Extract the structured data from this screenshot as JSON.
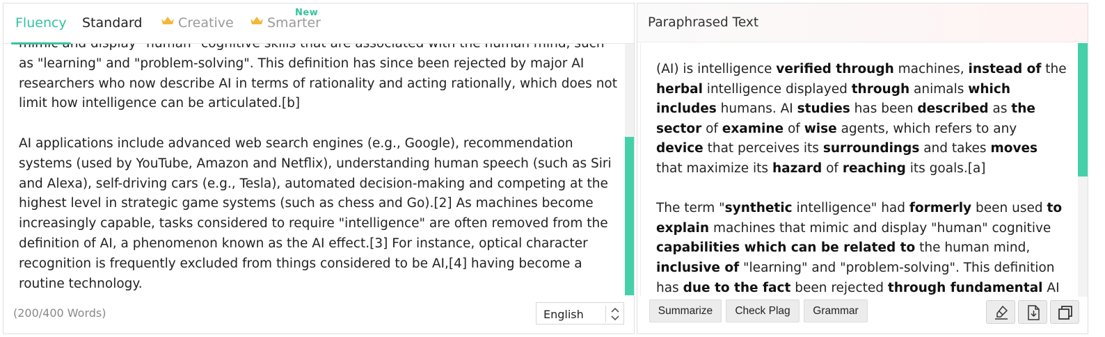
{
  "tabs": [
    {
      "label": "Fluency",
      "active": true,
      "premium": false
    },
    {
      "label": "Standard",
      "active": false,
      "premium": false
    },
    {
      "label": "Creative",
      "active": false,
      "premium": true
    },
    {
      "label": "Smarter",
      "active": false,
      "premium": true,
      "badge": "New"
    }
  ],
  "colors": {
    "accent": "#34c3a0",
    "scroll_thumb": "#44d1aa",
    "crown": "#f4b73a"
  },
  "source": {
    "paragraphs": [
      "mimic and display \"human\" cognitive skills that are associated with the human mind, such as \"learning\" and \"problem-solving\". This definition has since been rejected by major AI researchers who now describe AI in terms of rationality and acting rationally, which does not limit how intelligence can be articulated.[b]",
      "AI applications include advanced web search engines (e.g., Google), recommendation systems (used by YouTube, Amazon and Netflix), understanding human speech (such as Siri and Alexa), self-driving cars (e.g., Tesla), automated decision-making and competing at the highest level in strategic game systems (such as chess and Go).[2] As machines become increasingly capable, tasks considered to require \"intelligence\" are often removed from the definition of AI, a phenomenon known as the AI effect.[3] For instance, optical character recognition is frequently excluded from things considered to be AI,[4] having become a routine technology."
    ],
    "word_count": "(200/400 Words)",
    "language": "English"
  },
  "output": {
    "title": "Paraphrased Text",
    "paragraphs": [
      [
        {
          "t": "(AI) is intelligence ",
          "b": false
        },
        {
          "t": "verified through",
          "b": true
        },
        {
          "t": " machines, ",
          "b": false
        },
        {
          "t": "instead of",
          "b": true
        },
        {
          "t": " the ",
          "b": false
        },
        {
          "t": "herbal",
          "b": true
        },
        {
          "t": " intelligence displayed ",
          "b": false
        },
        {
          "t": "through",
          "b": true
        },
        {
          "t": " animals ",
          "b": false
        },
        {
          "t": "which includes",
          "b": true
        },
        {
          "t": " humans. AI ",
          "b": false
        },
        {
          "t": "studies",
          "b": true
        },
        {
          "t": " has been ",
          "b": false
        },
        {
          "t": "described",
          "b": true
        },
        {
          "t": " as ",
          "b": false
        },
        {
          "t": "the sector",
          "b": true
        },
        {
          "t": " of ",
          "b": false
        },
        {
          "t": "examine",
          "b": true
        },
        {
          "t": " of ",
          "b": false
        },
        {
          "t": "wise",
          "b": true
        },
        {
          "t": " agents, which refers to any ",
          "b": false
        },
        {
          "t": "device",
          "b": true
        },
        {
          "t": " that perceives its ",
          "b": false
        },
        {
          "t": "surroundings",
          "b": true
        },
        {
          "t": " and takes ",
          "b": false
        },
        {
          "t": "moves",
          "b": true
        },
        {
          "t": " that maximize its ",
          "b": false
        },
        {
          "t": "hazard",
          "b": true
        },
        {
          "t": " of ",
          "b": false
        },
        {
          "t": "reaching",
          "b": true
        },
        {
          "t": " its goals.[a]",
          "b": false
        }
      ],
      [
        {
          "t": "The term \"",
          "b": false
        },
        {
          "t": "synthetic",
          "b": true
        },
        {
          "t": " intelligence\" had ",
          "b": false
        },
        {
          "t": "formerly",
          "b": true
        },
        {
          "t": " been used ",
          "b": false
        },
        {
          "t": "to explain",
          "b": true
        },
        {
          "t": " machines that mimic and display \"human\" cognitive ",
          "b": false
        },
        {
          "t": "capabilities which can be related to",
          "b": true
        },
        {
          "t": " the human mind, ",
          "b": false
        },
        {
          "t": "inclusive of",
          "b": true
        },
        {
          "t": " \"learning\" and \"problem-solving\". This definition has ",
          "b": false
        },
        {
          "t": "due to the fact",
          "b": true
        },
        {
          "t": " been rejected ",
          "b": false
        },
        {
          "t": "through fundamental",
          "b": true
        },
        {
          "t": " AI",
          "b": false
        }
      ]
    ],
    "buttons": {
      "summarize": "Summarize",
      "check_plag": "Check Plag",
      "grammar": "Grammar"
    },
    "icons": [
      "highlighter-icon",
      "download-icon",
      "copy-icon"
    ]
  }
}
